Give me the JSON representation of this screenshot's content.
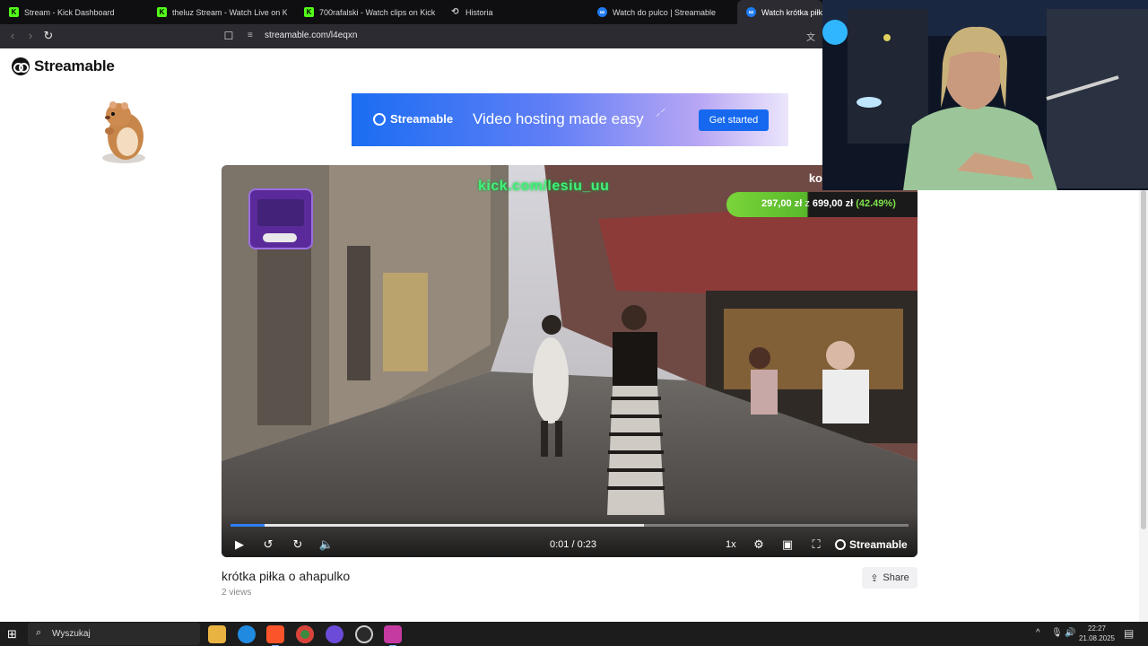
{
  "browser": {
    "tabs": [
      {
        "label": "Stream - Kick Dashboard",
        "favicon": "kick-icon"
      },
      {
        "label": "theluz Stream - Watch Live on Ki",
        "favicon": "kick-icon"
      },
      {
        "label": "700rafalski - Watch clips on Kick",
        "favicon": "kick-icon"
      },
      {
        "label": "Historia",
        "favicon": "history-icon"
      },
      {
        "label": "Watch do pulco | Streamable",
        "favicon": "streamable-icon"
      },
      {
        "label": "Watch krótka piłka o",
        "favicon": "streamable-icon",
        "active": true
      }
    ],
    "url": "streamable.com/l4eqxn"
  },
  "site": {
    "logo_text": "Streamable",
    "banner": {
      "logo_text": "Streamable",
      "tagline": "Video hosting made easy",
      "cta": "Get started"
    }
  },
  "video": {
    "overlay_watermark": "kick.com/lesiu_uu",
    "overlay_corner": "ko",
    "goal": {
      "current": "297,00 zł",
      "separator": "z",
      "target": "699,00 zł",
      "percent": "(42.49%)",
      "progress": 0.4249
    },
    "current_time": "0:01",
    "duration": "0:23",
    "time_display": "0:01 / 0:23",
    "played_fraction": 0.05,
    "buffered_fraction": 0.61,
    "speed": "1x",
    "brand": "Streamable",
    "title": "krótka piłka o ahapulko",
    "views": "2 views",
    "share_label": "Share"
  },
  "taskbar": {
    "search_placeholder": "Wyszukaj",
    "time": "22:27",
    "date": "21.08.2025"
  },
  "colors": {
    "accent": "#1e6ff1",
    "kick_green": "#53fc18",
    "tab_bg": "#0f0f12",
    "toolbar_bg": "#2b2b31",
    "taskbar_bg": "#1c1c1c"
  }
}
